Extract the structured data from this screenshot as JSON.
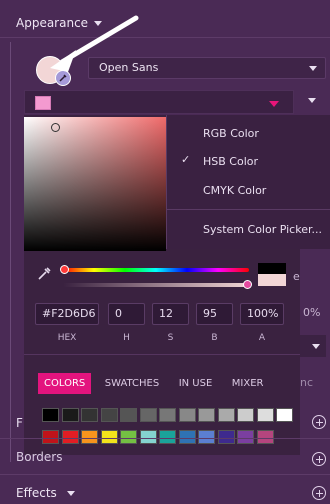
{
  "appearance": {
    "title": "Appearance"
  },
  "font": {
    "family": "Open Sans"
  },
  "color": {
    "current": "#F2D6D6",
    "accent": "#e3147e",
    "swatch": "#f49ad0"
  },
  "menu": {
    "items": [
      {
        "label": "RGB Color",
        "checked": false
      },
      {
        "label": "HSB Color",
        "checked": true
      },
      {
        "label": "CMYK Color",
        "checked": false
      },
      {
        "label": "System Color Picker...",
        "checked": false
      }
    ]
  },
  "fields": {
    "hex": {
      "value": "#F2D6D6",
      "label": "HEX"
    },
    "h": {
      "value": "0",
      "label": "H"
    },
    "s": {
      "value": "12",
      "label": "S"
    },
    "b": {
      "value": "95",
      "label": "B"
    },
    "a": {
      "value": "100%",
      "label": "A"
    }
  },
  "tabs": [
    "COLORS",
    "SWATCHES",
    "IN USE",
    "MIXER"
  ],
  "swatches_row1": [
    "#000000",
    "#1a1a1a",
    "#333333",
    "#444444",
    "#555555",
    "#666666",
    "#777777",
    "#888888",
    "#999999",
    "#aaaaaa",
    "#cccccc",
    "#dddddd",
    "#ffffff"
  ],
  "swatches_row2": [
    "#c0131a",
    "#e21d24",
    "#f7941d",
    "#f2e31b",
    "#74c043",
    "#84d3cf",
    "#1aa39a",
    "#2f72b3",
    "#5b7fd1",
    "#3e2a8e",
    "#7b3fa0",
    "#b4457e"
  ],
  "peeks": {
    "right1": "e",
    "right2": "0%",
    "right3": "nc",
    "f_label": "F",
    "borders_label": "Borders"
  },
  "effects": {
    "label": "Effects"
  }
}
